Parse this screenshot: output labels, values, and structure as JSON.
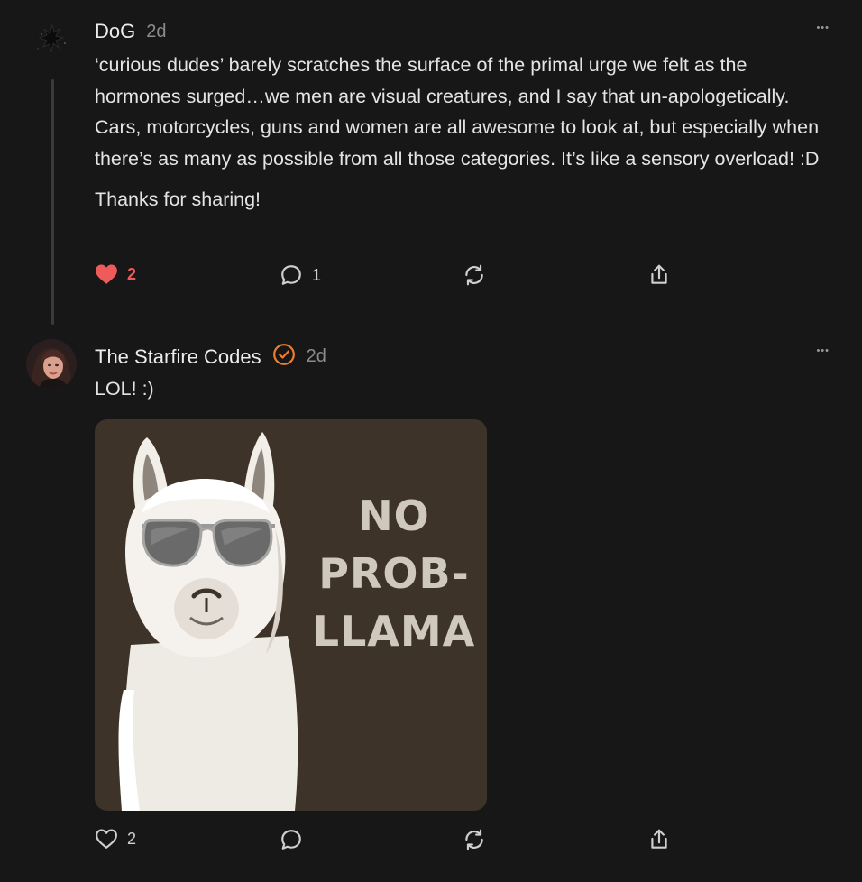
{
  "comments": [
    {
      "author": "DoG",
      "time": "2d",
      "more": "•••",
      "paragraphs": [
        "‘curious dudes’ barely scratches the surface of the primal urge we felt as the hormones surged…we men are visual creatures, and I say that un-apologetically. Cars, motorcycles, guns and women are all awesome to look at, but especially when there’s as many as possible from all those categories. It’s like a sensory overload! :D",
        "Thanks for sharing!"
      ],
      "likes": "2",
      "liked": true,
      "replies": "1"
    },
    {
      "author": "The Starfire Codes",
      "verified": true,
      "time": "2d",
      "more": "•••",
      "text": "LOL! :)",
      "image": {
        "line1": "NO",
        "line2": "PROB-",
        "line3": "LLAMA"
      },
      "likes": "2",
      "liked": false,
      "replies": ""
    }
  ],
  "icons": {
    "heart": "heart-icon",
    "reply": "speech-bubble-icon",
    "restack": "restack-icon",
    "share": "share-icon",
    "verified": "verified-check-icon"
  },
  "colors": {
    "background": "#171717",
    "liked": "#ef5b5b",
    "verified": "#f27d2c",
    "image_bg": "#3e3328"
  }
}
